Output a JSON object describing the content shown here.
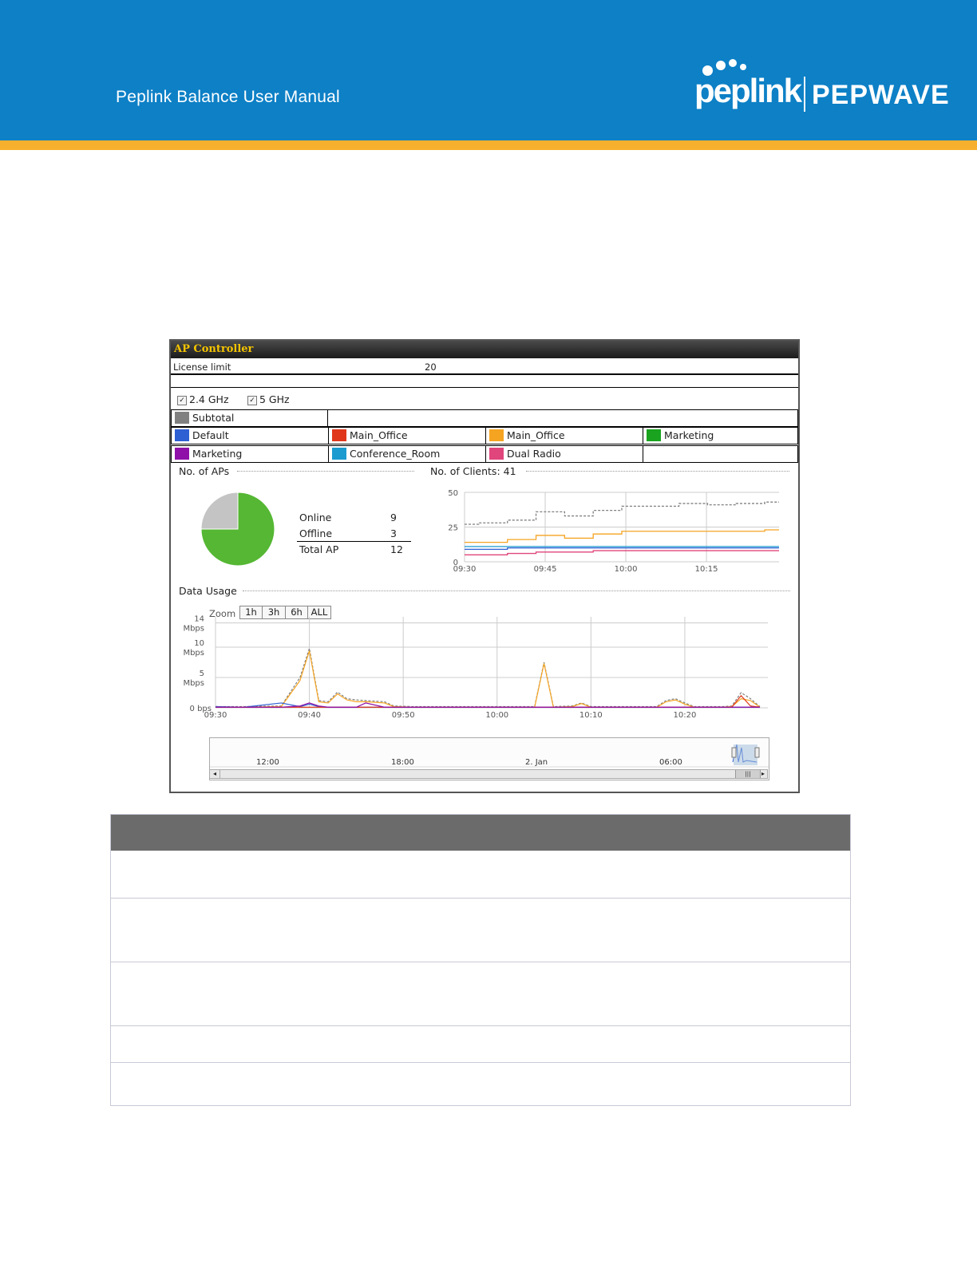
{
  "header": {
    "title": "Peplink Balance User Manual",
    "brand_primary": "peplink",
    "brand_secondary": "PEPWAVE",
    "colors": {
      "banner": "#0d80c6",
      "stripe": "#f7b02d"
    }
  },
  "panel": {
    "title": "AP Controller",
    "license_label": "License limit",
    "license_value": "20",
    "bands": [
      {
        "label": "2.4 GHz",
        "checked": true
      },
      {
        "label": "5 GHz",
        "checked": true
      }
    ],
    "legend": [
      {
        "label": "Subtotal",
        "color": "#808080"
      },
      {
        "label": "Default",
        "color": "#2e5fd3"
      },
      {
        "label": "Main_Office",
        "color": "#e0371b"
      },
      {
        "label": "Main_Office",
        "color": "#f5a422"
      },
      {
        "label": "Marketing",
        "color": "#1aa31f"
      },
      {
        "label": "Marketing",
        "color": "#8e10a8"
      },
      {
        "label": "Conference_Room",
        "color": "#1b9bd0"
      },
      {
        "label": "Dual Radio",
        "color": "#e0457b"
      }
    ],
    "aps": {
      "heading": "No. of APs",
      "online_label": "Online",
      "online_value": "9",
      "offline_label": "Offline",
      "offline_value": "3",
      "total_label": "Total AP",
      "total_value": "12",
      "pie_colors": {
        "online": "#55b733",
        "offline": "#c4c4c4"
      }
    },
    "clients": {
      "heading": "No. of Clients: 41"
    },
    "data_usage": {
      "heading": "Data Usage",
      "zoom_label": "Zoom",
      "zoom_options": [
        "1h",
        "3h",
        "6h",
        "ALL"
      ],
      "navigator_labels": [
        "12:00",
        "18:00",
        "2. Jan",
        "06:00"
      ]
    }
  },
  "chart_data": [
    {
      "type": "pie",
      "title": "No. of APs",
      "categories": [
        "Online",
        "Offline"
      ],
      "values": [
        9,
        3
      ]
    },
    {
      "type": "line",
      "title": "No. of Clients: 41",
      "x_ticks": [
        "09:30",
        "09:45",
        "10:00",
        "10:15"
      ],
      "y_ticks": [
        "0",
        "25",
        "50"
      ],
      "ylim": [
        0,
        50
      ],
      "x": [
        "09:30",
        "09:35",
        "09:40",
        "09:45",
        "09:50",
        "09:55",
        "10:00",
        "10:05",
        "10:10",
        "10:15",
        "10:20",
        "10:25"
      ],
      "series": [
        {
          "name": "Subtotal",
          "color": "#808080",
          "values": [
            27,
            28,
            30,
            36,
            33,
            37,
            40,
            40,
            42,
            41,
            42,
            43
          ]
        },
        {
          "name": "Main_Office",
          "color": "#f5a422",
          "values": [
            14,
            14,
            16,
            19,
            17,
            20,
            22,
            22,
            22,
            22,
            22,
            23
          ]
        },
        {
          "name": "Conference_Room",
          "color": "#1b9bd0",
          "values": [
            11,
            11,
            11,
            11,
            11,
            11,
            11,
            11,
            11,
            11,
            11,
            11
          ]
        },
        {
          "name": "Default",
          "color": "#2e5fd3",
          "values": [
            9,
            9,
            10,
            10,
            10,
            10,
            10,
            10,
            10,
            10,
            10,
            10
          ]
        },
        {
          "name": "Dual Radio",
          "color": "#e0457b",
          "values": [
            5,
            5,
            6,
            7,
            7,
            8,
            8,
            8,
            8,
            8,
            8,
            8
          ]
        }
      ]
    },
    {
      "type": "line",
      "title": "Data Usage",
      "x_ticks": [
        "09:30",
        "09:40",
        "09:50",
        "10:00",
        "10:10",
        "10:20"
      ],
      "y_ticks": [
        "0 bps",
        "5 Mbps",
        "10 Mbps",
        "14 Mbps"
      ],
      "ylim": [
        0,
        15
      ],
      "x_minutes": [
        0,
        3,
        7,
        9,
        10,
        11,
        12,
        13,
        14,
        15,
        16,
        18,
        19,
        21,
        22,
        23,
        26,
        31,
        33,
        34,
        35,
        36,
        38,
        39,
        40,
        44,
        46,
        47,
        48,
        49,
        50,
        51,
        52,
        53,
        54,
        55,
        56,
        57,
        58
      ],
      "series": [
        {
          "name": "Subtotal",
          "color": "#808080",
          "values": [
            0.2,
            0.2,
            0.3,
            5,
            9.8,
            1.2,
            1.0,
            2.6,
            1.5,
            1.3,
            1.2,
            1.0,
            0.3,
            0.2,
            0.2,
            0.2,
            0.2,
            0.2,
            0.2,
            0.2,
            7.5,
            0.2,
            0.3,
            0.8,
            0.2,
            0.2,
            0.2,
            0.2,
            1.2,
            1.5,
            0.8,
            0.2,
            0.2,
            0.2,
            0.2,
            0.3,
            2.5,
            1.5,
            0.2
          ]
        },
        {
          "name": "Main_Office",
          "color": "#f5a422",
          "values": [
            0.1,
            0.1,
            0.2,
            4.5,
            9.4,
            1.0,
            0.8,
            2.3,
            1.3,
            1.0,
            1.0,
            0.8,
            0.2,
            0.1,
            0.1,
            0.1,
            0.1,
            0.1,
            0.1,
            0.1,
            7.3,
            0.1,
            0.2,
            0.7,
            0.1,
            0.1,
            0.1,
            0.1,
            1.0,
            1.3,
            0.6,
            0.1,
            0.1,
            0.1,
            0.1,
            0.2,
            1.5,
            1.2,
            0.1
          ]
        },
        {
          "name": "Default",
          "color": "#2e5fd3",
          "values": [
            0.2,
            0.1,
            0.8,
            0.2,
            0.6,
            0.2,
            0.1,
            0.1,
            0.1,
            0.1,
            0.1,
            0.1,
            0.1,
            0.1,
            0.1,
            0.1,
            0.1,
            0.1,
            0.1,
            0.1,
            0.1,
            0.1,
            0.1,
            0.1,
            0.1,
            0.1,
            0.1,
            0.1,
            0.1,
            0.1,
            0.1,
            0.1,
            0.1,
            0.1,
            0.1,
            0.1,
            0.1,
            0.1,
            0.1
          ]
        },
        {
          "name": "Main_Office",
          "color": "#e0371b",
          "values": [
            0.1,
            0.1,
            0.1,
            0.1,
            0.1,
            0.1,
            0.1,
            0.1,
            0.1,
            0.1,
            0.1,
            0.1,
            0.1,
            0.1,
            0.1,
            0.1,
            0.1,
            0.1,
            0.1,
            0.1,
            0.1,
            0.1,
            0.1,
            0.1,
            0.1,
            0.1,
            0.1,
            0.1,
            0.1,
            0.1,
            0.1,
            0.1,
            0.1,
            0.1,
            0.1,
            0.1,
            2.0,
            0.3,
            0.1
          ]
        },
        {
          "name": "Marketing",
          "color": "#8e10a8",
          "values": [
            0.1,
            0.1,
            0.1,
            0.3,
            0.8,
            0.3,
            0.1,
            0.1,
            0.1,
            0.1,
            0.8,
            0.1,
            0.1,
            0.1,
            0.1,
            0.1,
            0.1,
            0.1,
            0.1,
            0.1,
            0.1,
            0.1,
            0.1,
            0.1,
            0.1,
            0.1,
            0.1,
            0.1,
            0.1,
            0.1,
            0.1,
            0.1,
            0.1,
            0.1,
            0.1,
            0.1,
            0.1,
            0.1,
            0.1
          ]
        }
      ]
    }
  ]
}
